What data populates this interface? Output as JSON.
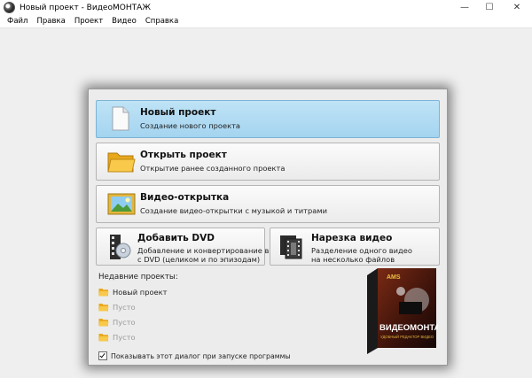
{
  "window": {
    "title": "Новый проект - ВидеоМОНТАЖ"
  },
  "menu": [
    "Файл",
    "Правка",
    "Проект",
    "Видео",
    "Справка"
  ],
  "dialog": {
    "actions": [
      {
        "title": "Новый проект",
        "desc": "Создание нового проекта",
        "icon": "blank-document-icon"
      },
      {
        "title": "Открыть проект",
        "desc": "Открытие ранее созданного проекта",
        "icon": "folder-icon"
      },
      {
        "title": "Видео-открытка",
        "desc": "Создание видео-открытки с музыкой и титрами",
        "icon": "picture-icon"
      },
      {
        "title": "Добавить DVD",
        "desc": [
          "Добавление и конвертирование видео",
          "с DVD (целиком и по эпизодам)"
        ],
        "icon": "dvd-film-icon"
      },
      {
        "title": "Нарезка видео",
        "desc": [
          "Разделение одного видео",
          "на несколько файлов"
        ],
        "icon": "film-strip-icon"
      }
    ],
    "recent_title": "Недавние проекты:",
    "recent": [
      "Новый проект",
      "Пусто",
      "Пусто",
      "Пусто"
    ],
    "show_on_start_label": "Показывать этот диалог при запуске программы",
    "show_on_start_checked": true,
    "box": {
      "brand": "AMS",
      "title": "ВИДЕОМОНТАЖ",
      "subtitle": "УДОБНЫЙ РЕДАКТОР ВИДЕО"
    }
  },
  "colors": {
    "selected": "#a9d6f1",
    "folder": "#f7c033"
  }
}
